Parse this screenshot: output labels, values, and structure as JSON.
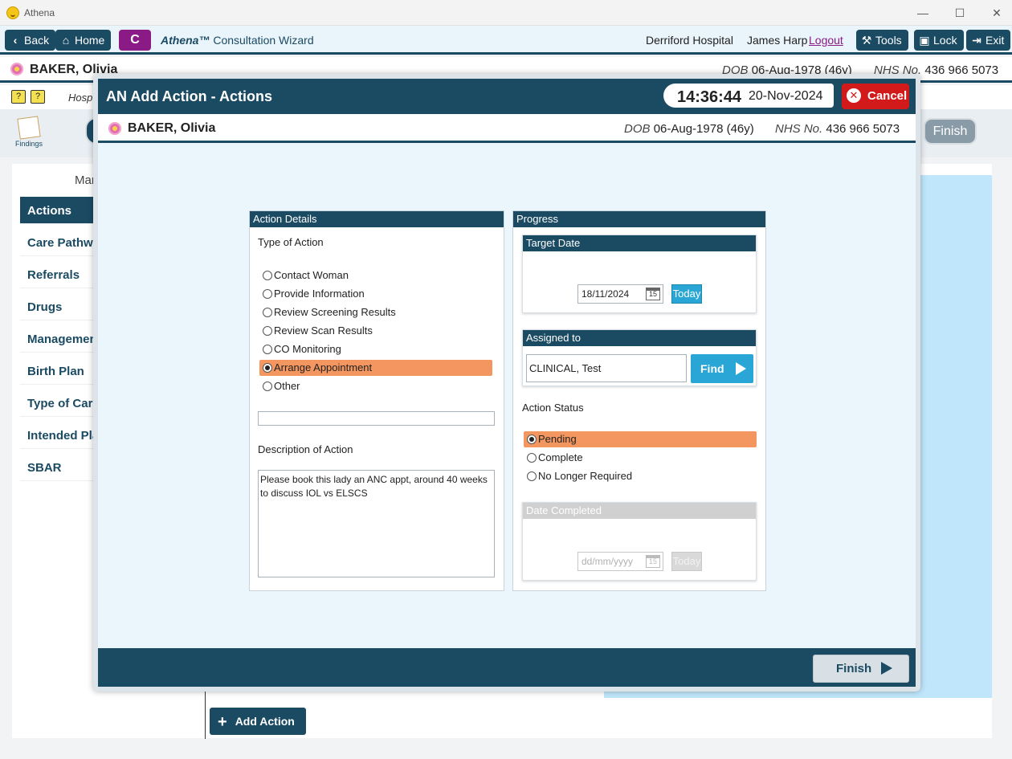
{
  "window": {
    "title": "Athena",
    "controls": [
      "—",
      "☐",
      "✕"
    ]
  },
  "toolbar": {
    "back_label": "Back",
    "home_label": "Home",
    "c_label": "C",
    "wizard_brand": "Athena™",
    "wizard_title": "Consultation Wizard",
    "hospital": "Derriford Hospital",
    "user": "James Harp",
    "logout_label": "Logout",
    "tools_label": "Tools",
    "lock_label": "Lock",
    "exit_label": "Exit"
  },
  "patient": {
    "name": "BAKER, Olivia",
    "dob_label": "DOB",
    "dob_value": "06-Aug-1978 (46y)",
    "nhs_label": "NHS No.",
    "nhs_value": "436 966 5073"
  },
  "background": {
    "hospital_fragment": "Hosp",
    "findings_label": "Findings",
    "section_fragment": "Mar",
    "finish_label": "Finish",
    "add_action_label": "Add Action",
    "sidebar": [
      {
        "label": "Actions",
        "active": true
      },
      {
        "label": "Care Pathways",
        "active": false
      },
      {
        "label": "Referrals",
        "active": false
      },
      {
        "label": "Drugs",
        "active": false
      },
      {
        "label": "Management",
        "active": false
      },
      {
        "label": "Birth Plan",
        "active": false
      },
      {
        "label": "Type of Care",
        "active": false
      },
      {
        "label": "Intended Place",
        "active": false
      },
      {
        "label": "SBAR",
        "active": false
      }
    ]
  },
  "modal": {
    "title": "AN Add Action - Actions",
    "time": "14:36:44",
    "date": "20-Nov-2024",
    "cancel_label": "Cancel",
    "finish_label": "Finish",
    "action_details": {
      "header": "Action Details",
      "type_label": "Type of Action",
      "options": [
        {
          "label": "Contact Woman",
          "selected": false
        },
        {
          "label": "Provide Information",
          "selected": false
        },
        {
          "label": "Review Screening Results",
          "selected": false
        },
        {
          "label": "Review Scan Results",
          "selected": false
        },
        {
          "label": "CO Monitoring",
          "selected": false
        },
        {
          "label": "Arrange Appointment",
          "selected": true
        },
        {
          "label": "Other",
          "selected": false
        }
      ],
      "other_value": "",
      "description_label": "Description of Action",
      "description_value": "Please book this lady an ANC appt, around 40 weeks to discuss IOL vs ELSCS"
    },
    "progress": {
      "header": "Progress",
      "target_date": {
        "header": "Target Date",
        "value": "18/11/2024",
        "cal_day": "15",
        "today_label": "Today"
      },
      "assigned_to": {
        "header": "Assigned to",
        "value": "CLINICAL, Test",
        "find_label": "Find"
      },
      "status_label": "Action Status",
      "status_options": [
        {
          "label": "Pending",
          "selected": true
        },
        {
          "label": "Complete",
          "selected": false
        },
        {
          "label": "No Longer Required",
          "selected": false
        }
      ],
      "date_completed": {
        "header": "Date Completed",
        "placeholder": "dd/mm/yyyy",
        "cal_day": "15",
        "today_label": "Today"
      }
    }
  },
  "colors": {
    "primary": "#1b4a63",
    "accent_purple": "#8a1a86",
    "selected_orange": "#f4965f",
    "find_blue": "#2aa6d6",
    "cancel_red": "#d31a1a",
    "modal_bg": "#eaf5fc"
  }
}
